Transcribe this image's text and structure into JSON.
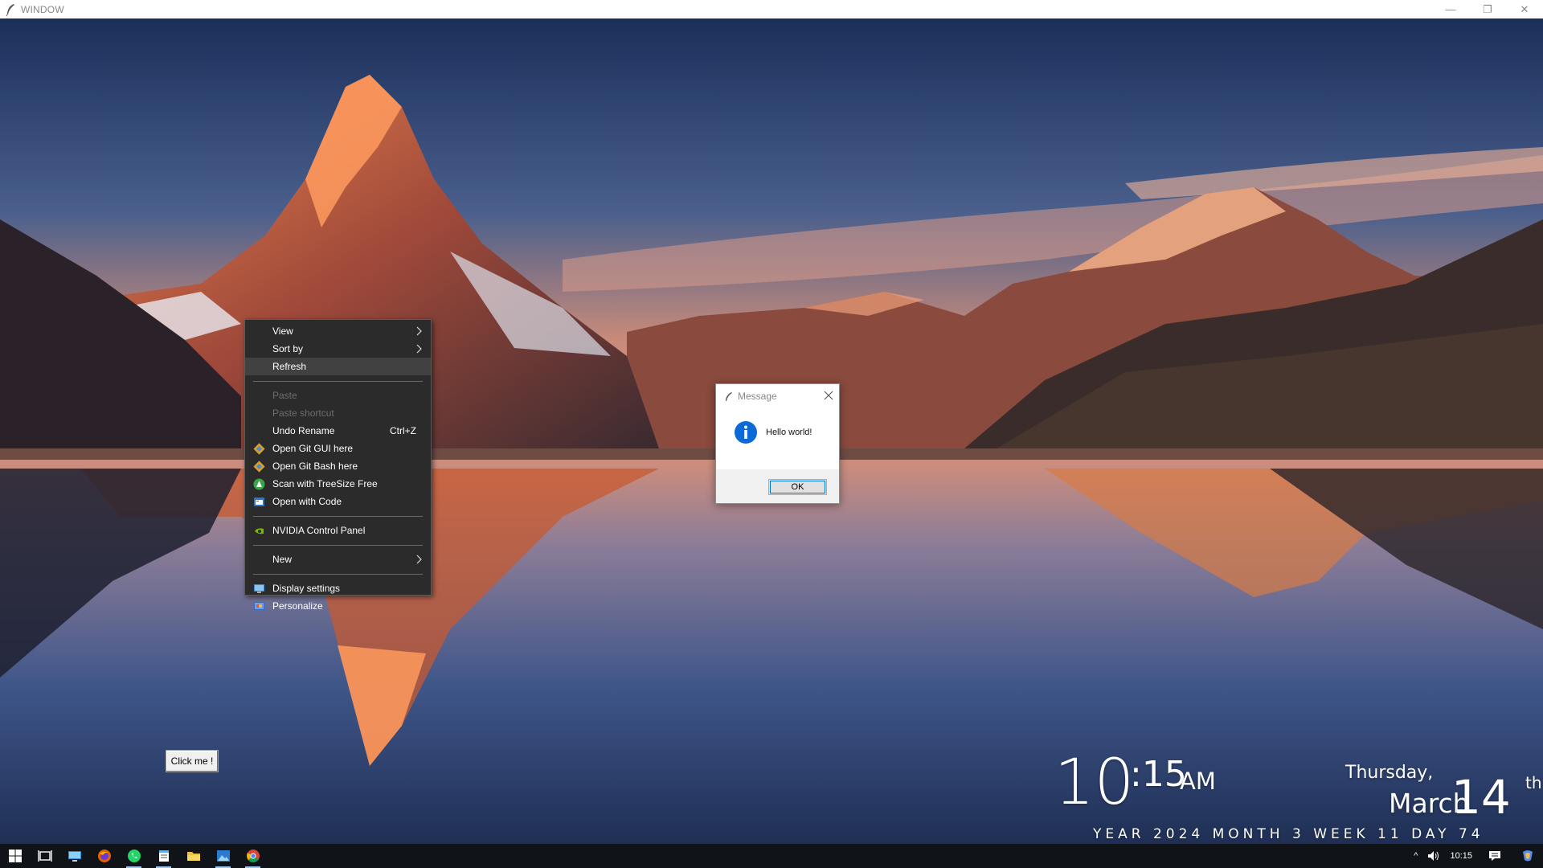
{
  "window": {
    "title": "WINDOW",
    "minimize_glyph": "—",
    "restore_glyph": "❐",
    "close_glyph": "✕"
  },
  "context_menu": {
    "items": [
      {
        "label": "View",
        "icon": "",
        "submenu": true
      },
      {
        "label": "Sort by",
        "icon": "",
        "submenu": true
      },
      {
        "label": "Refresh",
        "icon": "",
        "highlighted": true
      },
      {
        "label": "Paste",
        "icon": "",
        "disabled": true
      },
      {
        "label": "Paste shortcut",
        "icon": "",
        "disabled": true
      },
      {
        "label": "Undo Rename",
        "shortcut": "Ctrl+Z"
      },
      {
        "label": "Open Git GUI here",
        "icon": "git-icon"
      },
      {
        "label": "Open Git Bash here",
        "icon": "git-icon"
      },
      {
        "label": "Scan with TreeSize Free",
        "icon": "treesize-icon"
      },
      {
        "label": "Open with Code",
        "icon": "vscode-icon"
      },
      {
        "label": "NVIDIA Control Panel",
        "icon": "nvidia-icon"
      },
      {
        "label": "New",
        "submenu": true
      },
      {
        "label": "Display settings",
        "icon": "display-icon"
      },
      {
        "label": "Personalize",
        "icon": "personalize-icon"
      }
    ]
  },
  "dialog": {
    "title": "Message",
    "message": "Hello world!",
    "ok_label": "OK"
  },
  "button": {
    "label": "Click me !"
  },
  "clock": {
    "hour": "10",
    "minute": ":15",
    "ampm": "AM",
    "weekday": "Thursday,",
    "month": "March",
    "day": "14",
    "day_suffix": "th",
    "stats": "YEAR 2024   MONTH 3   WEEK 11   DAY 74"
  },
  "taskbar": {
    "apps": [
      "start-icon",
      "task-view-icon",
      "this-pc-icon",
      "firefox-icon",
      "whatsapp-icon",
      "notepad-icon",
      "file-explorer-icon",
      "photos-icon",
      "chrome-icon"
    ],
    "time": "10:15",
    "tray_up_glyph": "^",
    "volume_glyph": "🔊"
  },
  "colors": {
    "menu_bg": "#2b2b2b",
    "menu_highlight": "#414141",
    "taskbar_bg": "#101418",
    "info_blue": "#0a6bd8"
  }
}
